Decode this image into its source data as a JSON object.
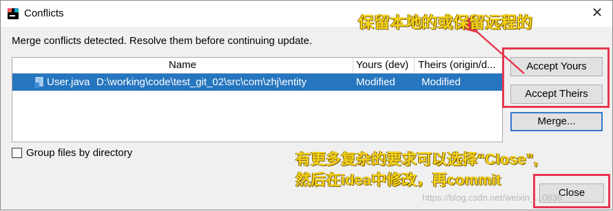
{
  "window": {
    "title": "Conflicts",
    "close_glyph": "✕"
  },
  "message": "Merge conflicts detected. Resolve them before continuing update.",
  "table": {
    "columns": [
      "Name",
      "Yours (dev)",
      "Theirs (origin/d..."
    ],
    "rows": [
      {
        "file": "User.java",
        "path": "D:\\working\\code\\test_git_02\\src\\com\\zhj\\entity",
        "yours": "Modified",
        "theirs": "Modified"
      }
    ]
  },
  "buttons": {
    "accept_yours": "Accept Yours",
    "accept_theirs": "Accept Theirs",
    "merge": "Merge...",
    "close": "Close"
  },
  "checkbox": {
    "label": "Group files by directory",
    "checked": false
  },
  "annotations": {
    "top": "保留本地的或保留远程的",
    "bottom_line1": "有更多复杂的要求可以选择“Close”,",
    "bottom_line2": "然后在idea中修改，再commit"
  },
  "watermark": "https://blog.csdn.net/weixin_...0838",
  "colors": {
    "selection": "#2675bf",
    "annotation": "#f5d318",
    "highlight_box": "#e8364e",
    "default_button_border": "#2f77d1"
  },
  "icons": {
    "app": "intellij-idea-icon",
    "file": "java-file-icon"
  }
}
